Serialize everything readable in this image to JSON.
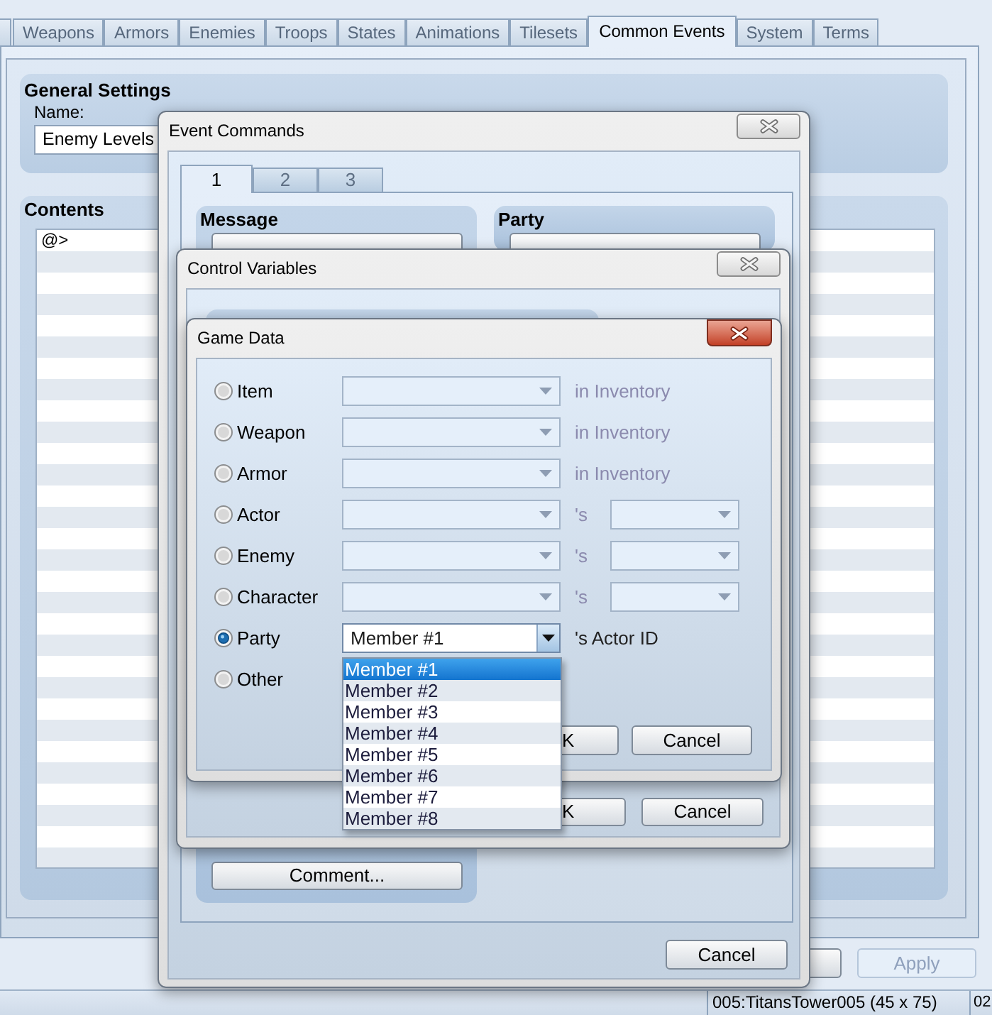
{
  "tabs": [
    {
      "label": "Weapons",
      "selected": false
    },
    {
      "label": "Armors",
      "selected": false
    },
    {
      "label": "Enemies",
      "selected": false
    },
    {
      "label": "Troops",
      "selected": false
    },
    {
      "label": "States",
      "selected": false
    },
    {
      "label": "Animations",
      "selected": false
    },
    {
      "label": "Tilesets",
      "selected": false
    },
    {
      "label": "Common Events",
      "selected": true
    },
    {
      "label": "System",
      "selected": false
    },
    {
      "label": "Terms",
      "selected": false
    }
  ],
  "general_settings": {
    "title": "General Settings",
    "name_label": "Name:",
    "name_value": "Enemy Levels"
  },
  "contents": {
    "title": "Contents",
    "rows": [
      "@>"
    ]
  },
  "apply_button": {
    "label": "Apply",
    "disabled": true
  },
  "status_bar": [
    "005:TitansTower005 (45 x 75)",
    "02"
  ],
  "event_commands": {
    "title": "Event Commands",
    "active": false,
    "tabs": [
      {
        "label": "1",
        "selected": true
      },
      {
        "label": "2",
        "selected": false
      },
      {
        "label": "3",
        "selected": false
      }
    ],
    "groups": [
      {
        "title": "Message",
        "bottom_button": "Comment..."
      },
      {
        "title": "Party"
      }
    ],
    "cancel_button": "Cancel"
  },
  "control_variables": {
    "title": "Control Variables",
    "active": false,
    "ok_button": "K",
    "cancel_button": "Cancel"
  },
  "game_data": {
    "title": "Game Data",
    "active": true,
    "options": [
      {
        "label": "Item",
        "selected": false,
        "kind": "combo",
        "suffix": "in Inventory"
      },
      {
        "label": "Weapon",
        "selected": false,
        "kind": "combo",
        "suffix": "in Inventory"
      },
      {
        "label": "Armor",
        "selected": false,
        "kind": "combo",
        "suffix": "in Inventory"
      },
      {
        "label": "Actor",
        "selected": false,
        "kind": "combo_pair",
        "suffix": "'s"
      },
      {
        "label": "Enemy",
        "selected": false,
        "kind": "combo_pair",
        "suffix": "'s"
      },
      {
        "label": "Character",
        "selected": false,
        "kind": "combo_pair",
        "suffix": "'s"
      },
      {
        "label": "Party",
        "selected": true,
        "kind": "combo",
        "value": "Member #1",
        "suffix": "'s Actor ID"
      },
      {
        "label": "Other",
        "selected": false,
        "kind": "plain"
      }
    ],
    "ok_button": "K",
    "cancel_button": "Cancel",
    "dropdown_list": [
      {
        "label": "Member #1",
        "selected": true
      },
      {
        "label": "Member #2",
        "selected": false
      },
      {
        "label": "Member #3",
        "selected": false
      },
      {
        "label": "Member #4",
        "selected": false
      },
      {
        "label": "Member #5",
        "selected": false
      },
      {
        "label": "Member #6",
        "selected": false
      },
      {
        "label": "Member #7",
        "selected": false
      },
      {
        "label": "Member #8",
        "selected": false
      }
    ]
  }
}
